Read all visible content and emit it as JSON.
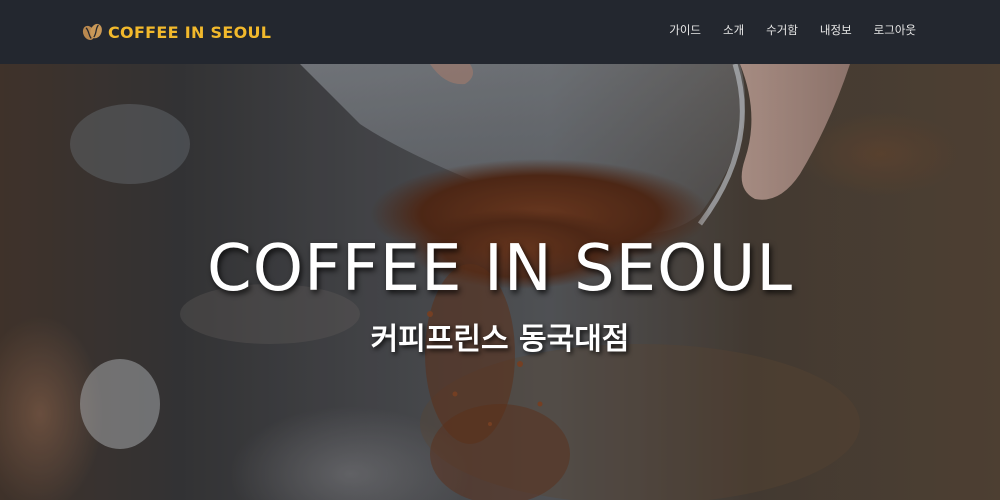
{
  "navbar": {
    "brand": {
      "icon": "coffee-bean-icon",
      "text": "COFFEE IN SEOUL",
      "color": "#f2b92c"
    },
    "links": [
      {
        "label": "가이드"
      },
      {
        "label": "소개"
      },
      {
        "label": "수거함"
      },
      {
        "label": "내정보"
      },
      {
        "label": "로그아웃"
      }
    ],
    "background": "#23272f"
  },
  "hero": {
    "image": "coffee-grounds-pouring-photo",
    "title": "COFFEE IN SEOUL",
    "subtitle": "커피프린스 동국대점"
  }
}
